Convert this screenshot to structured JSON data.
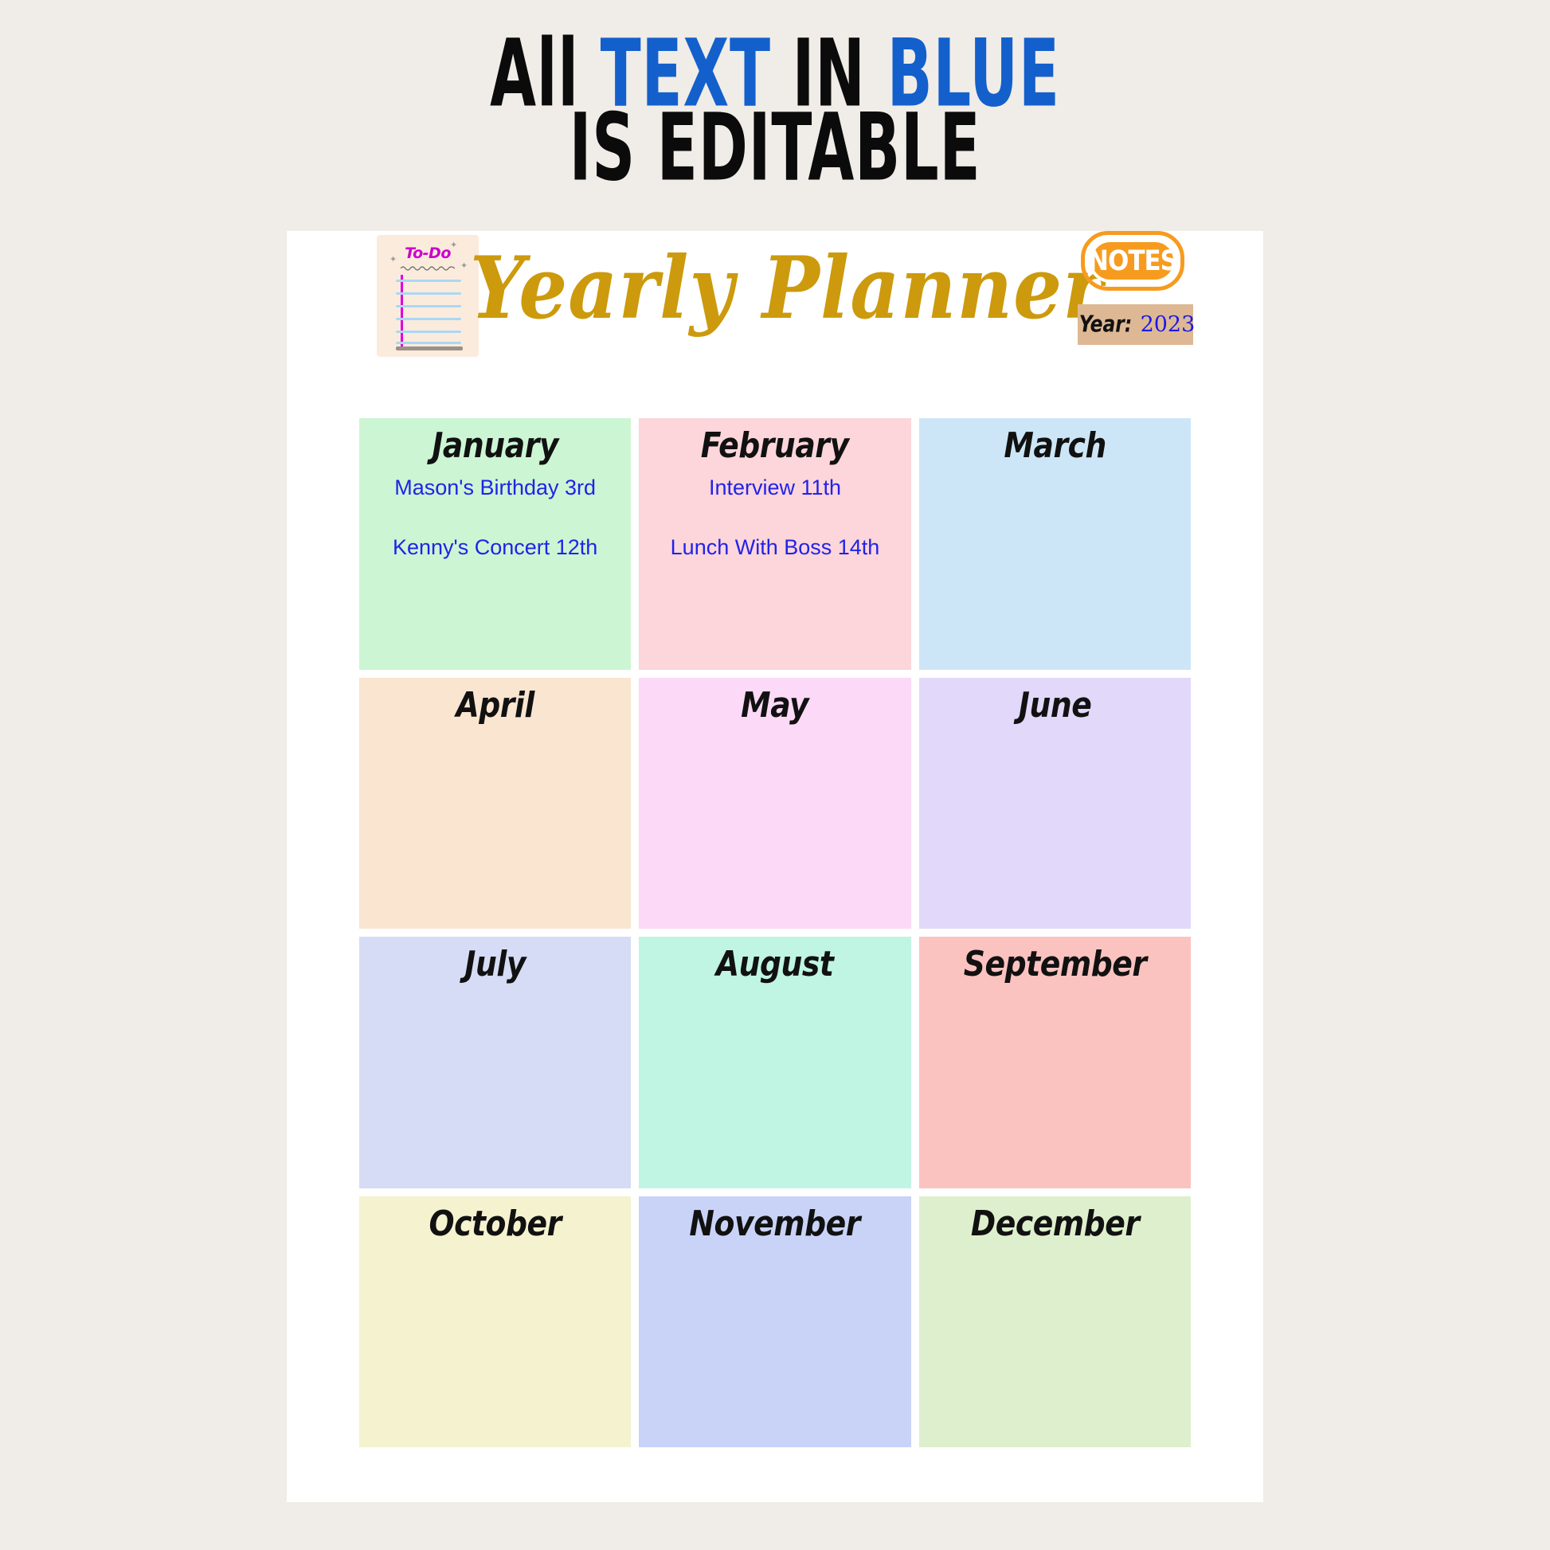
{
  "headline": {
    "line1_part1": "All ",
    "line1_part2": "TEXT",
    "line1_part3": " IN ",
    "line1_part4": "BLUE",
    "line2": "IS EDITABLE",
    "accent_color": "#1360CC",
    "text_color": "#0B0B0B"
  },
  "card": {
    "background": "#FFFFFF"
  },
  "page": {
    "background": "#F0ECE7"
  },
  "todo_pad": {
    "title": "To-Do",
    "title_color": "#CC00CC",
    "paper_color": "#FBEBDC",
    "rule_color": "#A9D8F5",
    "margin_line_color": "#E000E0",
    "bottom_rule_color": "#9B9189",
    "rule_count": 6
  },
  "title": {
    "text": "Yearly Planner",
    "color": "#CC9A0C"
  },
  "notes_badge": {
    "label": "NOTES",
    "color": "#F79B1E",
    "label_color": "#FFFFFF"
  },
  "year_field": {
    "label": "Year:",
    "value": "2023",
    "value_color": "#1A1AE8",
    "box_color": "#DEB894"
  },
  "months": [
    {
      "name": "January",
      "color": "#CCF5D4",
      "events": [
        "Mason's Birthday 3rd",
        "Kenny's Concert 12th"
      ]
    },
    {
      "name": "February",
      "color": "#FCD6DA",
      "events": [
        "Interview 11th",
        "Lunch With Boss 14th"
      ]
    },
    {
      "name": "March",
      "color": "#CDE6F7",
      "events": []
    },
    {
      "name": "April",
      "color": "#FAE5D1",
      "events": []
    },
    {
      "name": "May",
      "color": "#FBD9F7",
      "events": []
    },
    {
      "name": "June",
      "color": "#E2D8FA",
      "events": []
    },
    {
      "name": "July",
      "color": "#D6DCF5",
      "events": []
    },
    {
      "name": "August",
      "color": "#BFF5E2",
      "events": []
    },
    {
      "name": "September",
      "color": "#FBC3C0",
      "events": []
    },
    {
      "name": "October",
      "color": "#F5F2CF",
      "events": []
    },
    {
      "name": "November",
      "color": "#C9D3F7",
      "events": []
    },
    {
      "name": "December",
      "color": "#DEEFCD",
      "events": []
    }
  ]
}
